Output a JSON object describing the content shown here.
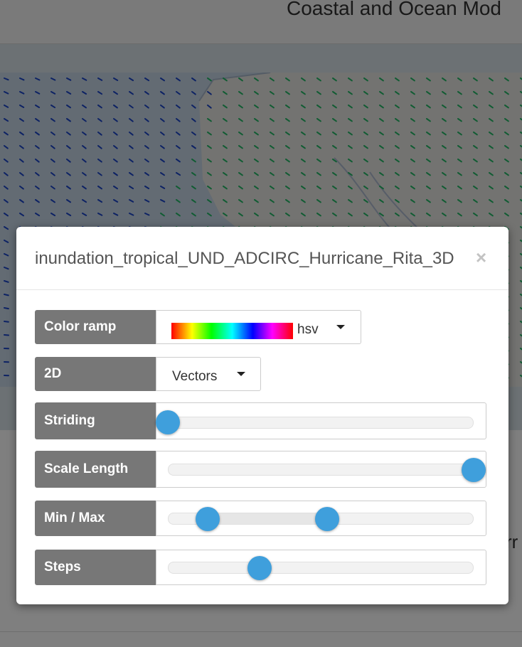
{
  "page": {
    "title": "Coastal and Ocean Mod",
    "stray_text": "rr"
  },
  "modal": {
    "title": "inundation_tropical_UND_ADCIRC_Hurricane_Rita_3D",
    "close_symbol": "×"
  },
  "controls": {
    "color_ramp": {
      "label": "Color ramp",
      "value": "hsv"
    },
    "mode_2d": {
      "label": "2D",
      "value": "Vectors"
    },
    "striding": {
      "label": "Striding",
      "fraction": 0.0
    },
    "scale_length": {
      "label": "Scale Length",
      "fraction": 1.0
    },
    "min_max": {
      "label": "Min / Max",
      "min_fraction": 0.13,
      "max_fraction": 0.52
    },
    "steps": {
      "label": "Steps",
      "fraction": 0.3
    }
  },
  "colors": {
    "label_bg": "#777777",
    "handle": "#3f9fdc",
    "vector_blue": "#1a44c8",
    "vector_green": "#22b866"
  },
  "icons": {
    "close": "close-icon",
    "caret": "caret-down-icon"
  }
}
